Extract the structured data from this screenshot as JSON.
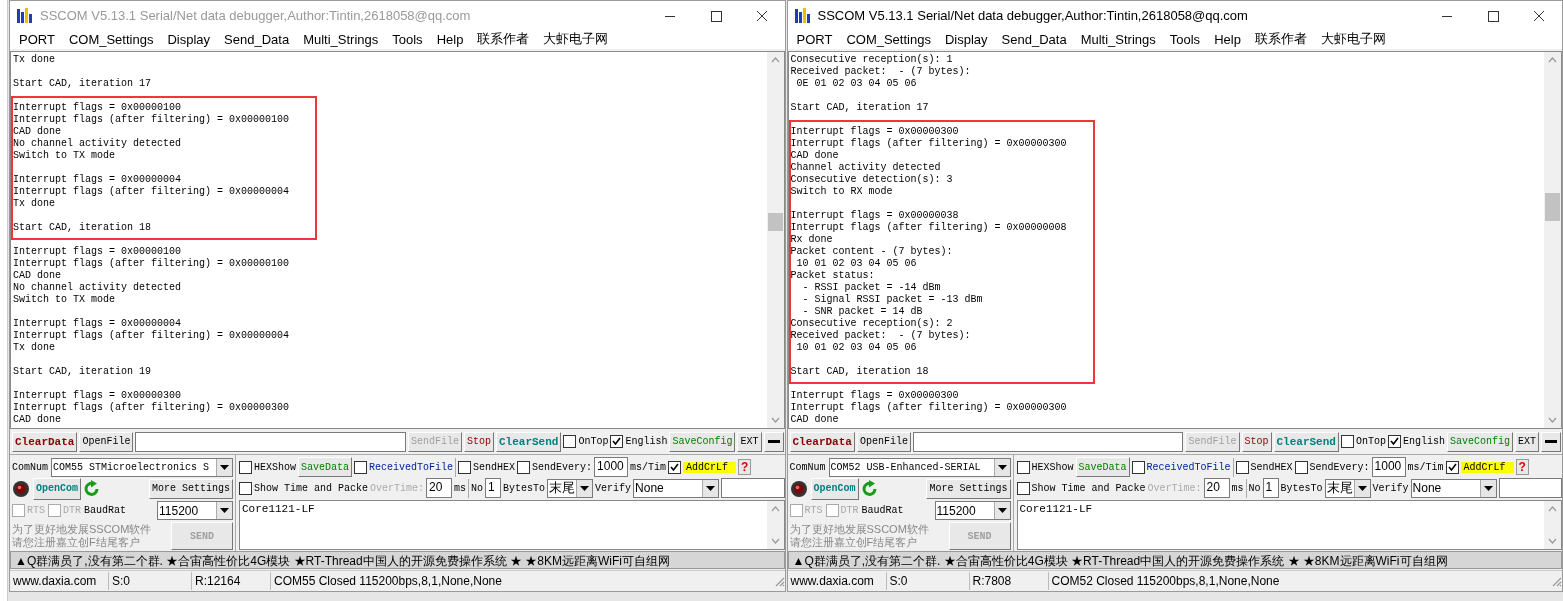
{
  "windows": [
    {
      "title": "SSCOM V5.13.1 Serial/Net data debugger,Author:Tintin,2618058@qq.com",
      "active": false,
      "menu": [
        "PORT",
        "COM_Settings",
        "Display",
        "Send_Data",
        "Multi_Strings",
        "Tools",
        "Help",
        "联系作者",
        "大虾电子网"
      ],
      "log": {
        "paragraphs": [
          {
            "lines": [
              "Tx done"
            ],
            "highlighted": false
          },
          {
            "lines": [
              "Start CAD, iteration 17"
            ],
            "highlighted": false
          },
          {
            "lines": [
              "Interrupt flags = 0x00000100",
              "Interrupt flags (after filtering) = 0x00000100",
              "CAD done",
              "No channel activity detected",
              "Switch to TX mode"
            ],
            "highlighted": true
          },
          {
            "lines": [
              "Interrupt flags = 0x00000004",
              "Interrupt flags (after filtering) = 0x00000004",
              "Tx done"
            ],
            "highlighted": true
          },
          {
            "lines": [
              "Start CAD, iteration 18"
            ],
            "highlighted": true
          },
          {
            "lines": [
              "Interrupt flags = 0x00000100",
              "Interrupt flags (after filtering) = 0x00000100",
              "CAD done",
              "No channel activity detected",
              "Switch to TX mode"
            ],
            "highlighted": false
          },
          {
            "lines": [
              "Interrupt flags = 0x00000004",
              "Interrupt flags (after filtering) = 0x00000004",
              "Tx done"
            ],
            "highlighted": false
          },
          {
            "lines": [
              "Start CAD, iteration 19"
            ],
            "highlighted": false
          },
          {
            "lines": [
              "Interrupt flags = 0x00000300",
              "Interrupt flags (after filtering) = 0x00000300",
              "CAD done"
            ],
            "highlighted": false
          }
        ]
      },
      "toolbar": {
        "clear_data": "ClearData",
        "open_file": "OpenFile",
        "send_file": {
          "label": "SendFile",
          "disabled": true
        },
        "stop": "Stop",
        "clear_send": "ClearSend",
        "on_top": {
          "label": "OnTop",
          "checked": false
        },
        "english": {
          "label": "English",
          "checked": true
        },
        "save_config": "SaveConfig",
        "ext": "EXT"
      },
      "port": {
        "com_label": "ComNum",
        "com_value": "COM55 STMicroelectronics S",
        "open_com": "OpenCom",
        "more_settings": "More Settings",
        "rts": {
          "label": "RTS",
          "checked": false,
          "disabled": true
        },
        "dtr": {
          "label": "DTR",
          "checked": false,
          "disabled": true
        },
        "baud_label": "BaudRat",
        "baud_value": "115200",
        "promo": [
          "为了更好地发展SSCOM软件",
          "请您注册嘉立创F结尾客户"
        ],
        "send": {
          "label": "SEND",
          "disabled": true
        }
      },
      "options": {
        "hex_show": {
          "label": "HEXShow",
          "checked": false
        },
        "save_data": "SaveData",
        "received_to_file": {
          "label": "ReceivedToFile",
          "checked": false
        },
        "send_hex": {
          "label": "SendHEX",
          "checked": false
        },
        "send_every": {
          "label": "SendEvery:",
          "checked": false
        },
        "interval": "1000",
        "interval_unit": "ms/Tim",
        "add_crlf": {
          "label": "AddCrLf",
          "checked": true
        },
        "help": "?",
        "show_time": {
          "label": "Show Time and Packe",
          "checked": false
        },
        "overtime_label": "OverTime:",
        "overtime": "20",
        "overtime_unit": "ms",
        "no_label": "No",
        "no_value": "1",
        "bytes_to_label": "BytesTo",
        "bytes_to_value": "末尾",
        "verify_label": "Verify",
        "verify_value": "None"
      },
      "send_text": "Core1121-LF",
      "marquee": "▲Q群满员了,没有第二个群. ★合宙高性价比4G模块 ★RT-Thread中国人的开源免费操作系统 ★ ★8KM远距离WiFi可自组网",
      "status_bar": [
        "www.daxia.com",
        "S:0",
        "R:12164",
        "COM55 Closed  115200bps,8,1,None,None"
      ]
    },
    {
      "title": "SSCOM V5.13.1 Serial/Net data debugger,Author:Tintin,2618058@qq.com",
      "active": true,
      "menu": [
        "PORT",
        "COM_Settings",
        "Display",
        "Send_Data",
        "Multi_Strings",
        "Tools",
        "Help",
        "联系作者",
        "大虾电子网"
      ],
      "log": {
        "paragraphs": [
          {
            "lines": [
              "Consecutive reception(s): 1",
              "Received packet:  - (7 bytes):",
              " 0E 01 02 03 04 05 06"
            ],
            "highlighted": false
          },
          {
            "lines": [
              "Start CAD, iteration 17"
            ],
            "highlighted": false
          },
          {
            "lines": [
              "Interrupt flags = 0x00000300",
              "Interrupt flags (after filtering) = 0x00000300",
              "CAD done",
              "Channel activity detected",
              "Consecutive detection(s): 3",
              "Switch to RX mode"
            ],
            "highlighted": true
          },
          {
            "lines": [
              "Interrupt flags = 0x00000038",
              "Interrupt flags (after filtering) = 0x00000008",
              "Rx done",
              "Packet content - (7 bytes):",
              " 10 01 02 03 04 05 06",
              "Packet status:",
              "  - RSSI packet = -14 dBm",
              "  - Signal RSSI packet = -13 dBm",
              "  - SNR packet = 14 dB",
              "Consecutive reception(s): 2",
              "Received packet:  - (7 bytes):",
              " 10 01 02 03 04 05 06"
            ],
            "highlighted": true
          },
          {
            "lines": [
              "Start CAD, iteration 18"
            ],
            "highlighted": true
          },
          {
            "lines": [
              "Interrupt flags = 0x00000300",
              "Interrupt flags (after filtering) = 0x00000300",
              "CAD done"
            ],
            "highlighted": false
          }
        ]
      },
      "toolbar": {
        "clear_data": "ClearData",
        "open_file": "OpenFile",
        "send_file": {
          "label": "SendFile",
          "disabled": true
        },
        "stop": "Stop",
        "clear_send": "ClearSend",
        "on_top": {
          "label": "OnTop",
          "checked": false
        },
        "english": {
          "label": "English",
          "checked": true
        },
        "save_config": "SaveConfig",
        "ext": "EXT"
      },
      "port": {
        "com_label": "ComNum",
        "com_value": "COM52 USB-Enhanced-SERIAL",
        "open_com": "OpenCom",
        "more_settings": "More Settings",
        "rts": {
          "label": "RTS",
          "checked": false,
          "disabled": true
        },
        "dtr": {
          "label": "DTR",
          "checked": false,
          "disabled": true
        },
        "baud_label": "BaudRat",
        "baud_value": "115200",
        "promo": [
          "为了更好地发展SSCOM软件",
          "请您注册嘉立创F结尾客户"
        ],
        "send": {
          "label": "SEND",
          "disabled": true
        }
      },
      "options": {
        "hex_show": {
          "label": "HEXShow",
          "checked": false
        },
        "save_data": "SaveData",
        "received_to_file": {
          "label": "ReceivedToFile",
          "checked": false
        },
        "send_hex": {
          "label": "SendHEX",
          "checked": false
        },
        "send_every": {
          "label": "SendEvery:",
          "checked": false
        },
        "interval": "1000",
        "interval_unit": "ms/Tim",
        "add_crlf": {
          "label": "AddCrLf",
          "checked": true
        },
        "help": "?",
        "show_time": {
          "label": "Show Time and Packe",
          "checked": false
        },
        "overtime_label": "OverTime:",
        "overtime": "20",
        "overtime_unit": "ms",
        "no_label": "No",
        "no_value": "1",
        "bytes_to_label": "BytesTo",
        "bytes_to_value": "末尾",
        "verify_label": "Verify",
        "verify_value": "None"
      },
      "send_text": "Core1121-LF",
      "marquee": "▲Q群满员了,没有第二个群. ★合宙高性价比4G模块 ★RT-Thread中国人的开源免费操作系统 ★ ★8KM远距离WiFi可自组网",
      "status_bar": [
        "www.daxia.com",
        "S:0",
        "R:7808",
        "COM52 Closed  115200bps,8,1,None,None"
      ]
    }
  ]
}
